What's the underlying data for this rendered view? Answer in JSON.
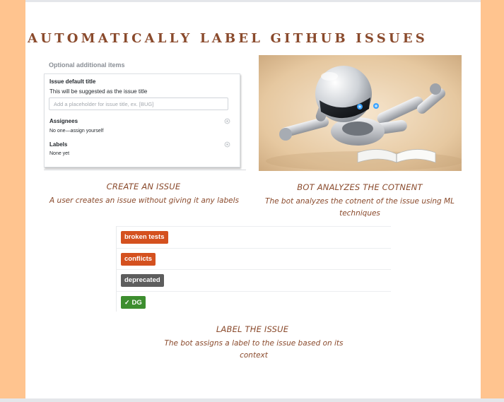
{
  "page": {
    "title": "AUTOMATICALLY LABEL GITHUB ISSUES"
  },
  "colors": {
    "side_stripes": "#ffc48f",
    "heading_text": "#8a4a2c",
    "label_broken_tests": "#d4511f",
    "label_conflicts": "#d4511f",
    "label_deprecated": "#5d5d5d",
    "label_dg": "#3d8e2f"
  },
  "issue_form": {
    "header": "Optional additional items",
    "default_title_label": "Issue default title",
    "default_title_hint": "This will be suggested as the issue title",
    "input_placeholder": "Add a placeholder for issue title, ex. [BUG]",
    "assignees_label": "Assignees",
    "assignees_value": "No one—assign yourself",
    "labels_label": "Labels",
    "labels_value": "None yet",
    "settings_icon": "gear-icon"
  },
  "robot_illustration": {
    "icon": "robot-reading-book-illustration"
  },
  "steps": [
    {
      "title": "CREATE AN ISSUE",
      "description": "A user creates an issue without giving it any labels"
    },
    {
      "title": "BOT ANALYZES THE COTNENT",
      "description": "The bot analyzes the cotnent of the issue using ML techniques"
    },
    {
      "title": "LABEL THE ISSUE",
      "description": "The bot assigns a label to the issue based on its context"
    }
  ],
  "labels": [
    {
      "name": "broken tests",
      "color": "#d4511f",
      "icon": ""
    },
    {
      "name": "conflicts",
      "color": "#d4511f",
      "icon": ""
    },
    {
      "name": "deprecated",
      "color": "#5d5d5d",
      "icon": ""
    },
    {
      "name": "DG",
      "color": "#3d8e2f",
      "icon": "check-icon"
    }
  ]
}
